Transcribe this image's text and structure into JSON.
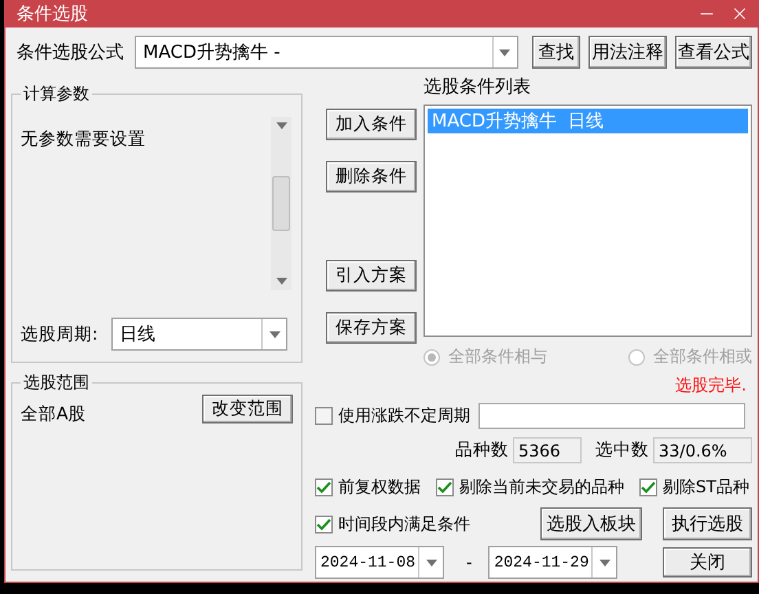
{
  "window": {
    "title": "条件选股"
  },
  "formula": {
    "label": "条件选股公式",
    "value": "MACD升势擒牛 -",
    "buttons": [
      "查找",
      "用法注释",
      "查看公式"
    ]
  },
  "params": {
    "title": "计算参数",
    "message": "无参数需要设置",
    "period_label": "选股周期:",
    "period_value": "日线"
  },
  "actions": [
    "加入条件",
    "删除条件",
    "引入方案",
    "保存方案"
  ],
  "conditions": {
    "title": "选股条件列表",
    "items": [
      {
        "label": "MACD升势擒牛  日线",
        "selected": true
      }
    ]
  },
  "logic": [
    {
      "label": "全部条件相与",
      "selected": true,
      "disabled": true
    },
    {
      "label": "全部条件相或",
      "selected": false,
      "disabled": true
    }
  ],
  "status": "选股完毕.",
  "scope": {
    "title": "选股范围",
    "value": "全部A股",
    "button": "改变范围"
  },
  "variable_period": {
    "label": "使用涨跌不定周期",
    "checked": false
  },
  "counts": [
    {
      "label": "品种数",
      "value": "5366"
    },
    {
      "label": "选中数",
      "value": "33/0.6%"
    }
  ],
  "options": [
    {
      "label": "前复权数据",
      "checked": true
    },
    {
      "label": "剔除当前未交易的品种",
      "checked": true
    },
    {
      "label": "剔除ST品种",
      "checked": true
    }
  ],
  "time_filter": {
    "label": "时间段内满足条件",
    "checked": true,
    "start": "2024-11-08",
    "separator": "-",
    "end": "2024-11-29"
  },
  "buttons": [
    "选股入板块",
    "执行选股",
    "关闭"
  ]
}
